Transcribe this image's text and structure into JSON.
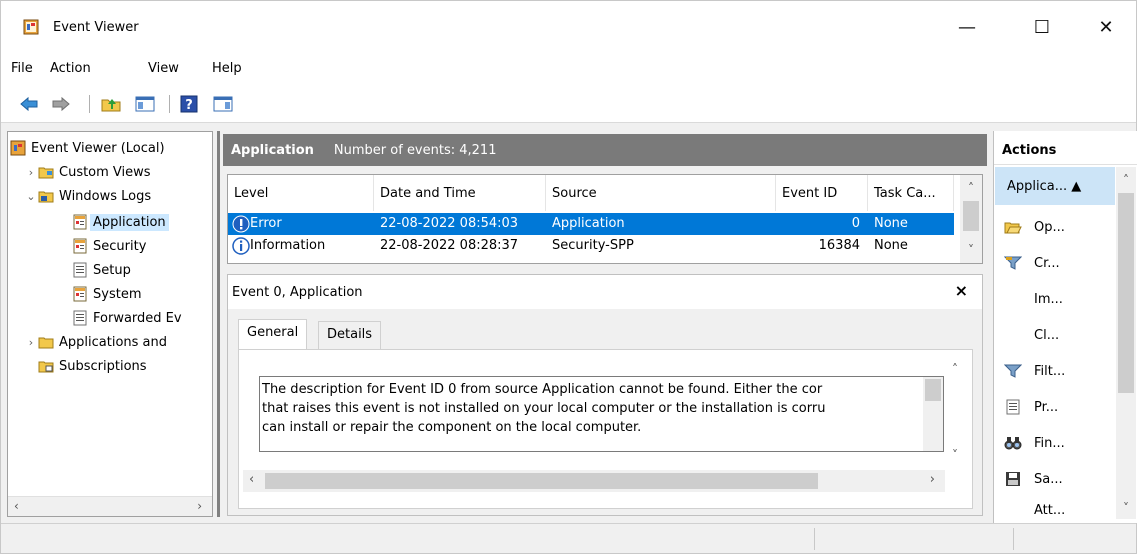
{
  "window": {
    "title": "Event Viewer",
    "controls": {
      "minimize": "—",
      "maximize": "☐",
      "close": "✕"
    }
  },
  "menu": [
    "File",
    "Action",
    "View",
    "Help"
  ],
  "toolbar": {
    "icons": [
      "back-icon",
      "forward-icon",
      "up-folder-icon",
      "show-hide-console-tree-icon",
      "help-icon",
      "show-hide-action-pane-icon"
    ]
  },
  "tree": {
    "items": [
      {
        "label": "Event Viewer (Local)",
        "icon": "event-viewer-icon",
        "arrow": ""
      },
      {
        "label": "Custom Views",
        "icon": "folder-icon",
        "arrow": "›"
      },
      {
        "label": "Windows Logs",
        "icon": "folder-icon",
        "arrow": "⌄"
      },
      {
        "label": "Application",
        "icon": "log-icon",
        "arrow": "",
        "selected": true
      },
      {
        "label": "Security",
        "icon": "log-icon",
        "arrow": ""
      },
      {
        "label": "Setup",
        "icon": "log-icon",
        "arrow": ""
      },
      {
        "label": "System",
        "icon": "log-icon",
        "arrow": ""
      },
      {
        "label": "Forwarded Ev",
        "icon": "log-icon",
        "arrow": ""
      },
      {
        "label": "Applications and",
        "icon": "folder-icon",
        "arrow": "›"
      },
      {
        "label": "Subscriptions",
        "icon": "subscriptions-icon",
        "arrow": ""
      }
    ]
  },
  "center": {
    "title": "Application",
    "event_count": "Number of events: 4,211",
    "columns": [
      "Level",
      "Date and Time",
      "Source",
      "Event ID",
      "Task Ca..."
    ],
    "rows": [
      {
        "level": "Error",
        "datetime": "22-08-2022 08:54:03",
        "source": "Application",
        "event_id": "0",
        "task": "None"
      },
      {
        "level": "Information",
        "datetime": "22-08-2022 08:28:37",
        "source": "Security-SPP",
        "event_id": "16384",
        "task": "None"
      }
    ]
  },
  "detail": {
    "title": "Event 0, Application",
    "close": "×",
    "tabs": [
      "General",
      "Details"
    ],
    "description_lines": [
      "The description for Event ID 0 from source Application cannot be found. Either the cor",
      "that raises this event is not installed on your local computer or the installation is corru",
      "can install or repair the component on the local computer."
    ]
  },
  "actions": {
    "header": "Actions",
    "section": "Applica... ▲",
    "items": [
      {
        "label": "Op...",
        "icon": "open-folder-icon"
      },
      {
        "label": "Cr...",
        "icon": "filter-icon"
      },
      {
        "label": "Im...",
        "icon": ""
      },
      {
        "label": "Cl...",
        "icon": ""
      },
      {
        "label": "Filt...",
        "icon": "filter-icon"
      },
      {
        "label": "Pr...",
        "icon": "properties-icon"
      },
      {
        "label": "Fin...",
        "icon": "binoculars-icon"
      },
      {
        "label": "Sa...",
        "icon": "save-icon"
      },
      {
        "label": "Att...",
        "icon": ""
      }
    ]
  },
  "colors": {
    "selection": "#0078d7",
    "tree_selection": "#cce8ff",
    "header_gray": "#7a7a7a",
    "error_icon": "#1f5fbf",
    "info_icon": "#1f5fbf"
  }
}
